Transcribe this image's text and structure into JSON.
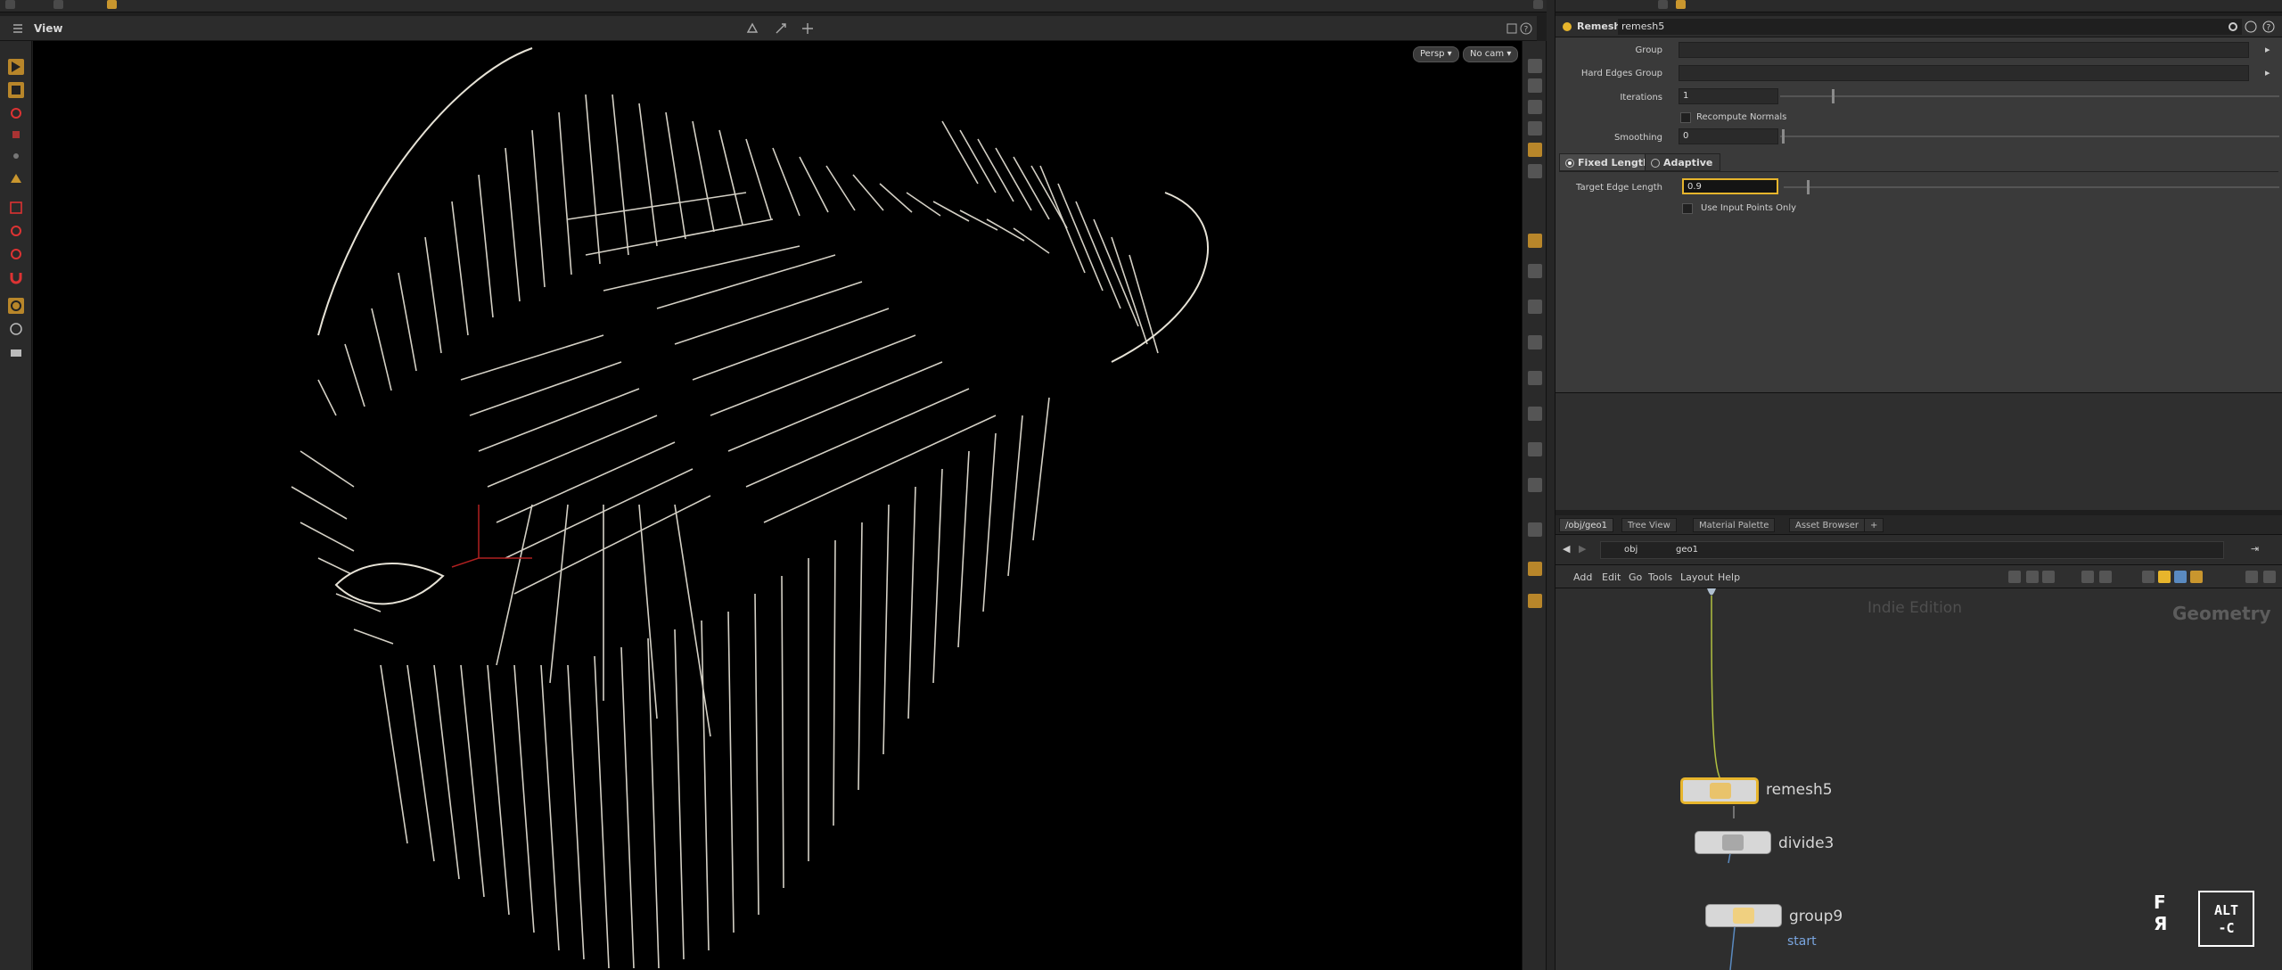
{
  "viewport": {
    "title": "View",
    "persp_button": "Persp ▾",
    "camera_button": "No cam ▾"
  },
  "params": {
    "node_type": "Remesh",
    "node_name": "remesh5",
    "group_label": "Group",
    "group_value": "",
    "hard_edges_label": "Hard Edges Group",
    "hard_edges_value": "",
    "iterations_label": "Iterations",
    "iterations_value": "1",
    "iterations_fraction": 0.1,
    "recompute_normals_label": "Recompute Normals",
    "recompute_normals_checked": false,
    "smoothing_label": "Smoothing",
    "smoothing_value": "0",
    "smoothing_fraction": 0.0,
    "tabs": [
      {
        "label": "Fixed Length",
        "active": true
      },
      {
        "label": "Adaptive",
        "active": false
      }
    ],
    "target_edge_label": "Target Edge Length",
    "target_edge_value": "0.9",
    "use_input_points_label": "Use Input Points Only",
    "use_input_points_checked": false
  },
  "network": {
    "tabs": [
      {
        "label": "/obj/geo1",
        "active": true
      },
      {
        "label": "Tree View",
        "active": false
      },
      {
        "label": "Material Palette",
        "active": false
      },
      {
        "label": "Asset Browser",
        "active": false
      },
      {
        "label": "+",
        "active": false
      }
    ],
    "path": [
      "obj",
      "geo1"
    ],
    "menu": [
      "Add",
      "Edit",
      "Go",
      "Tools",
      "Layout",
      "Help"
    ],
    "watermark_edition": "Indie Edition",
    "watermark_context": "Geometry",
    "nodes": [
      {
        "name": "remesh5",
        "selected": true,
        "icon": "remesh-icon"
      },
      {
        "name": "divide3",
        "selected": false,
        "icon": "divide-icon"
      },
      {
        "name": "group9",
        "selected": false,
        "icon": "group-icon",
        "comment": "start"
      }
    ]
  },
  "branding": {
    "fr_logo": "F\nR",
    "alt_logo_top": "ALT",
    "alt_logo_bottom": "-C"
  },
  "colors": {
    "accent": "#e7b52c",
    "viewport_bg": "#000000",
    "panel_bg": "#3a3a3a",
    "node_comment": "#7aa6e0"
  }
}
